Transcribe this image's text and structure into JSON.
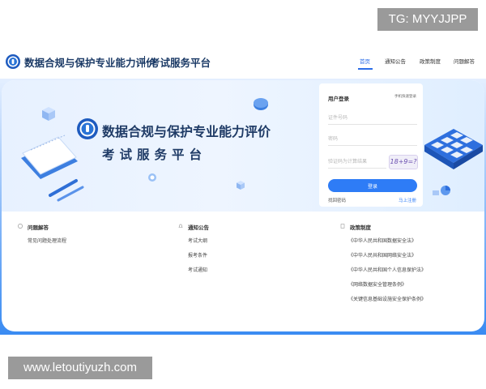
{
  "watermark_top": "TG: MYYJJPP",
  "watermark_bottom": "www.letoutiyuzh.com",
  "header": {
    "title": "数据合规与保护专业能力评价",
    "subtitle": "考试服务平台",
    "nav": [
      {
        "label": "首页",
        "active": true
      },
      {
        "label": "通知公告",
        "active": false
      },
      {
        "label": "政策制度",
        "active": false
      },
      {
        "label": "问题解答",
        "active": false
      }
    ]
  },
  "banner": {
    "title": "数据合规与保护专业能力评价",
    "subtitle": "考试服务平台"
  },
  "login": {
    "title": "用户登录",
    "switch_label": "手机快速登录",
    "id_placeholder": "证件号码",
    "password_placeholder": "密码",
    "captcha_placeholder": "验证码为计算结果",
    "captcha_text": "18+9=?",
    "button_label": "登录",
    "forgot_label": "找回密码",
    "register_label": "马上注册"
  },
  "sections": {
    "faq": {
      "heading": "问题解答",
      "items": [
        "常见问题处理流程"
      ]
    },
    "notices": {
      "heading": "通知公告",
      "items": [
        "考试大纲",
        "报考条件",
        "考试通知"
      ]
    },
    "policies": {
      "heading": "政策制度",
      "items": [
        "《中华人民共和国数据安全法》",
        "《中华人民共和国网络安全法》",
        "《中华人民共和国个人信息保护法》",
        "《网络数据安全管理条例》",
        "《关键信息基础设施安全保护条例》"
      ]
    }
  },
  "colors": {
    "accent": "#2e7cf6",
    "title": "#1b3a66",
    "frame_bottom": "#3a8bf2"
  }
}
